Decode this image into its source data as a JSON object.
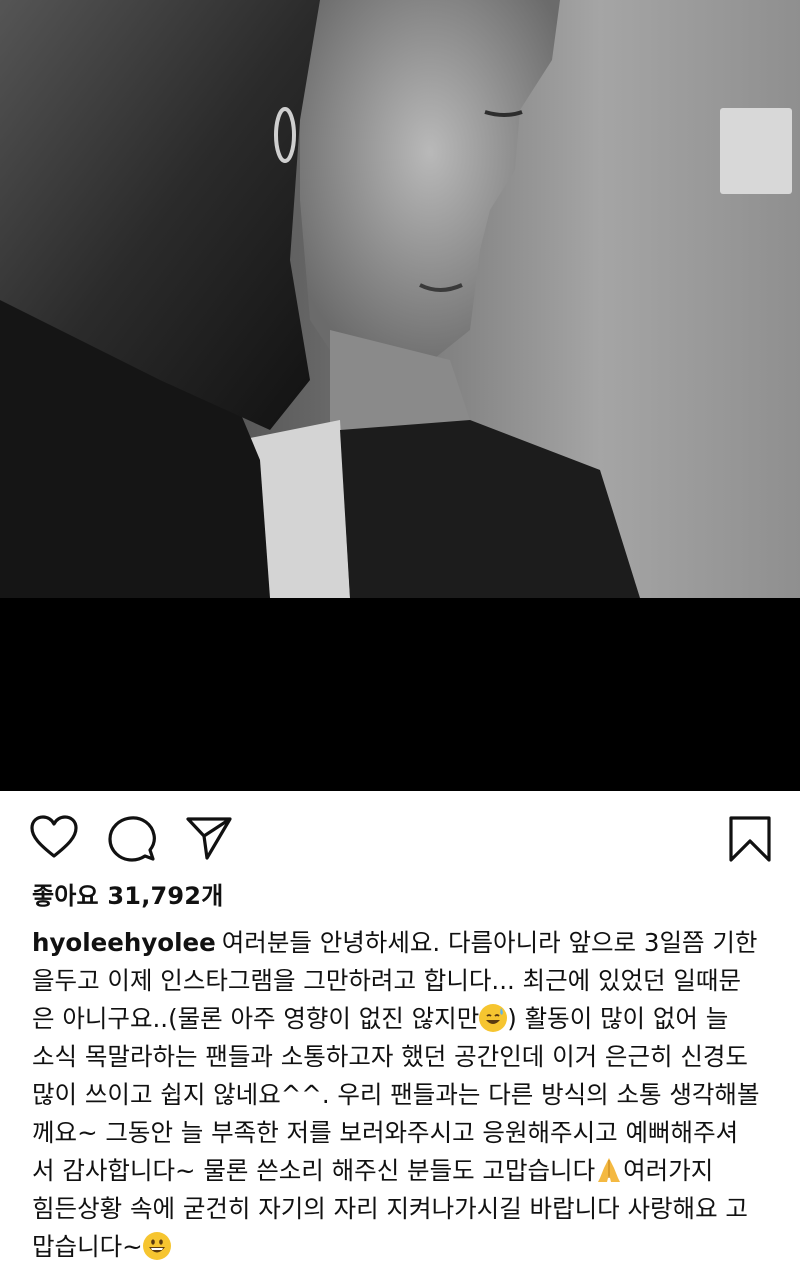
{
  "post": {
    "photo_alt": "black and white portrait",
    "actions": {
      "like_icon": "heart-icon",
      "comment_icon": "comment-icon",
      "share_icon": "send-icon",
      "save_icon": "bookmark-icon"
    },
    "likes_label": "좋아요 31,792개",
    "caption": {
      "username": "hyoleehyolee",
      "line1": "여러분들 안녕하세요. 다름아니라 앞으로 3일쯤 기한",
      "line2": "을두고 이제 인스타그램을 그만하려고 합니다... 최근에 있었던 일때문",
      "line3a": "은 아니구요..(물론 아주 영향이 없진 않지만",
      "line3b": ") 활동이 많이 없어 늘",
      "line4": "소식 목말라하는 팬들과 소통하고자 했던 공간인데 이거 은근히 신경도",
      "line5": "많이 쓰이고 쉽지 않네요^^. 우리 팬들과는 다른 방식의 소통 생각해볼",
      "line6": "께요~ 그동안 늘 부족한 저를 보러와주시고 응원해주시고 예뻐해주셔",
      "line7a": "서 감사합니다~ 물론 쓴소리 해주신 분들도 고맙습니다",
      "line7b": "여러가지",
      "line8": "힘든상황 속에 굳건히 자기의 자리 지켜나가시길 바랍니다 사랑해요 고",
      "line9": "맙습니다~",
      "emoji_1": "sweat-smile-emoji",
      "emoji_2": "folded-hands-emoji",
      "emoji_3": "grinning-emoji"
    }
  }
}
